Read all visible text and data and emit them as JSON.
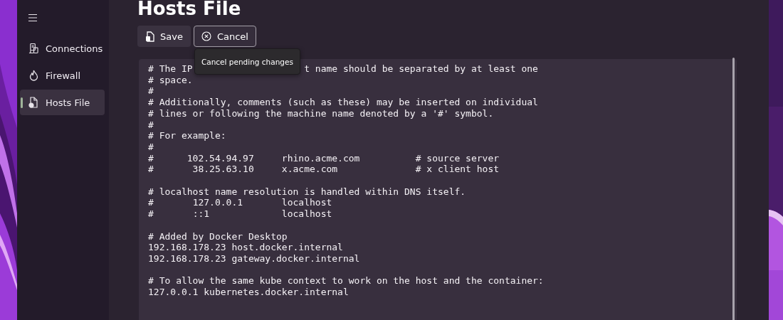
{
  "sidebar": {
    "items": [
      {
        "label": "Connections",
        "selected": false
      },
      {
        "label": "Firewall",
        "selected": false
      },
      {
        "label": "Hosts File",
        "selected": true
      }
    ]
  },
  "page": {
    "title": "Hosts File"
  },
  "toolbar": {
    "buttons": [
      {
        "label": "Save",
        "hovered": false
      },
      {
        "label": "Cancel",
        "hovered": true,
        "tooltip": "Cancel pending changes"
      }
    ]
  },
  "editor": {
    "covered_line": {
      "start": "# The IP",
      "end": "t name should be separated by at least one"
    },
    "text": "# space.\n#\n# Additionally, comments (such as these) may be inserted on individual\n# lines or following the machine name denoted by a '#' symbol.\n#\n# For example:\n#\n#      102.54.94.97     rhino.acme.com          # source server\n#       38.25.63.10     x.acme.com              # x client host\n\n# localhost name resolution is handled within DNS itself.\n#\t127.0.0.1       localhost\n#\t::1             localhost\n\n# Added by Docker Desktop\n192.168.178.23 host.docker.internal\n192.168.178.23 gateway.docker.internal\n\n# To allow the same kube context to work on the host and the container:\n127.0.0.1 kubernetes.docker.internal"
  }
}
